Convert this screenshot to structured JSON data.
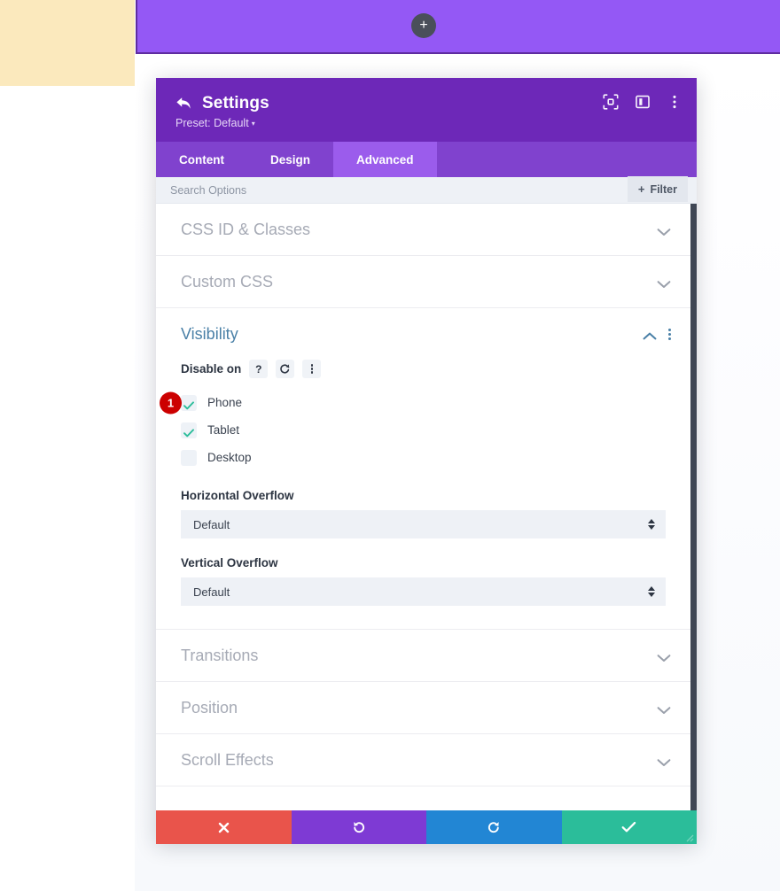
{
  "builder": {
    "add_module_label": "+",
    "section_bar_color": "#9458f5",
    "section_border_color": "#5f2ca0",
    "cream_block_color": "#fbe9bd"
  },
  "modal": {
    "title": "Settings",
    "preset_label": "Preset: Default",
    "preset_caret": "▾",
    "header_color": "#6d28b8",
    "icons": [
      {
        "name": "focus-target-icon"
      },
      {
        "name": "panel-layout-icon"
      },
      {
        "name": "more-options-icon"
      }
    ],
    "tabs": [
      {
        "label": "Content",
        "active": false
      },
      {
        "label": "Design",
        "active": false
      },
      {
        "label": "Advanced",
        "active": true
      }
    ],
    "search": {
      "placeholder": "Search Options",
      "value": ""
    },
    "filter": {
      "plus": "+",
      "label": "Filter"
    },
    "sections": [
      {
        "title": "CSS ID & Classes",
        "open": false
      },
      {
        "title": "Custom CSS",
        "open": false
      },
      {
        "title": "Visibility",
        "open": true
      },
      {
        "title": "Transitions",
        "open": false
      },
      {
        "title": "Position",
        "open": false
      },
      {
        "title": "Scroll Effects",
        "open": false
      }
    ],
    "visibility": {
      "disable_on_label": "Disable on",
      "help_glyph": "?",
      "reset_glyph": "↺",
      "devices": [
        {
          "label": "Phone",
          "checked": true,
          "badge": "1"
        },
        {
          "label": "Tablet",
          "checked": true,
          "badge": ""
        },
        {
          "label": "Desktop",
          "checked": false,
          "badge": ""
        }
      ],
      "horizontal_overflow": {
        "label": "Horizontal Overflow",
        "value": "Default"
      },
      "vertical_overflow": {
        "label": "Vertical Overflow",
        "value": "Default"
      }
    },
    "footer": [
      {
        "name": "cancel",
        "icon": "close-icon",
        "color": "#e9544b"
      },
      {
        "name": "undo",
        "icon": "undo-icon",
        "color": "#7e3ad4"
      },
      {
        "name": "redo",
        "icon": "redo-icon",
        "color": "#2286d4"
      },
      {
        "name": "save",
        "icon": "check-icon",
        "color": "#2bbd9a"
      }
    ]
  }
}
